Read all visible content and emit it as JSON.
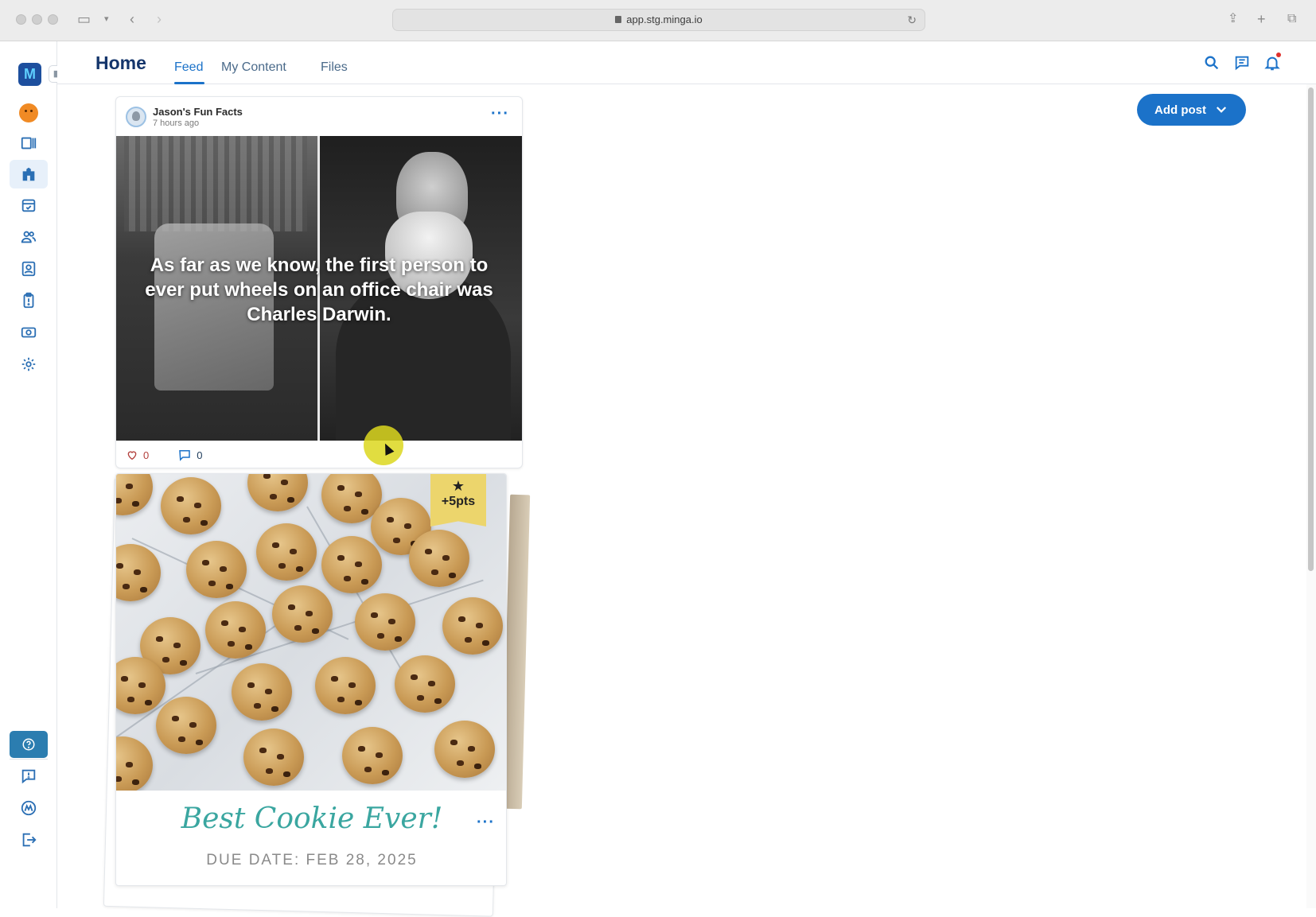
{
  "browser": {
    "url": "app.stg.minga.io"
  },
  "header": {
    "title": "Home",
    "tabs": [
      {
        "label": "Feed",
        "active": true
      },
      {
        "label": "My Content",
        "active": false
      },
      {
        "label": "Files",
        "active": false
      }
    ]
  },
  "sidebar": {
    "items": [
      {
        "icon": "avatar-icon"
      },
      {
        "icon": "id-card-icon"
      },
      {
        "icon": "school-icon",
        "active": true
      },
      {
        "icon": "calendar-icon"
      },
      {
        "icon": "people-icon"
      },
      {
        "icon": "profile-icon"
      },
      {
        "icon": "clipboard-icon"
      },
      {
        "icon": "ticket-icon"
      },
      {
        "icon": "settings-icon"
      }
    ],
    "bottom": [
      {
        "icon": "help-icon"
      },
      {
        "icon": "feedback-icon"
      },
      {
        "icon": "minga-icon"
      },
      {
        "icon": "logout-icon"
      }
    ]
  },
  "actions": {
    "add_post_label": "Add post"
  },
  "feed": {
    "post": {
      "author": "Jason's Fun Facts",
      "time": "7 hours ago",
      "image_text": "As far as we know, the first person to ever put wheels on an office chair was Charles Darwin.",
      "likes": "0",
      "comments": "0"
    },
    "challenge": {
      "points": "+5pts",
      "title": "Best Cookie Ever!",
      "due_date": "DUE DATE: FEB 28, 2025"
    }
  },
  "colors": {
    "primary": "#1b72c9",
    "title": "#14356b",
    "badge": "#ecd56c",
    "challenge_title": "#3aa6a0"
  }
}
